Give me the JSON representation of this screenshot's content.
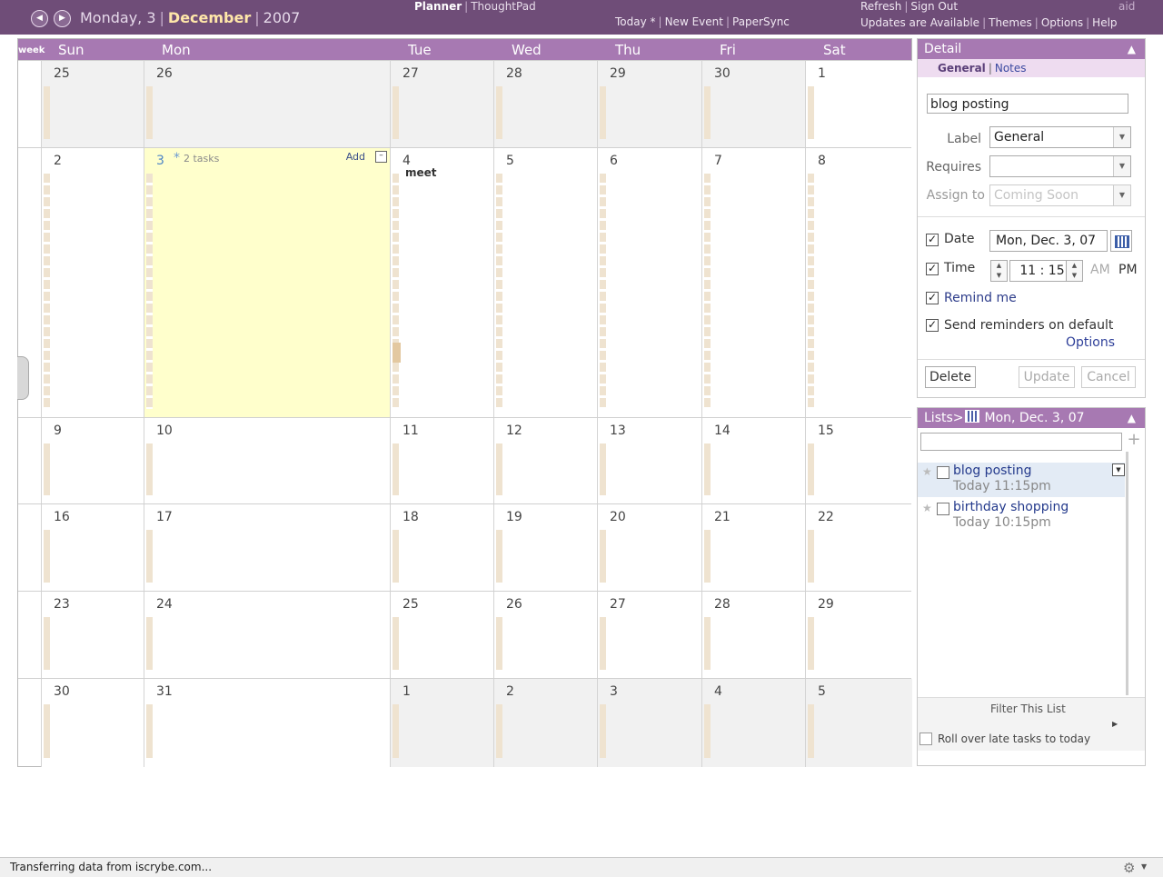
{
  "header": {
    "prev_icon": "chevron-left-icon",
    "next_icon": "chevron-right-icon",
    "weekday_day": "Monday, 3",
    "month": "December",
    "year": "2007",
    "app_active": "Planner",
    "app_other": "ThoughtPad",
    "today_link": "Today *",
    "new_event_link": "New Event",
    "papersync_link": "PaperSync",
    "refresh_link": "Refresh",
    "signout_link": "Sign Out",
    "updates_link": "Updates are Available",
    "themes_link": "Themes",
    "options_link": "Options",
    "help_link": "Help",
    "user": "aid"
  },
  "calendar": {
    "week_tag": "week",
    "weekdays": [
      "Sun",
      "Mon",
      "Tue",
      "Wed",
      "Thu",
      "Fri",
      "Sat"
    ],
    "weeks": [
      [
        "25",
        "26",
        "27",
        "28",
        "29",
        "30",
        "1"
      ],
      [
        "2",
        "3",
        "4",
        "5",
        "6",
        "7",
        "8"
      ],
      [
        "9",
        "10",
        "11",
        "12",
        "13",
        "14",
        "15"
      ],
      [
        "16",
        "17",
        "18",
        "19",
        "20",
        "21",
        "22"
      ],
      [
        "23",
        "24",
        "25",
        "26",
        "27",
        "28",
        "29"
      ],
      [
        "30",
        "31",
        "1",
        "2",
        "3",
        "4",
        "5"
      ]
    ],
    "today_star": "*",
    "today_tasks": "2 tasks",
    "add_label": "Add",
    "collapse_symbol": "–",
    "event_tue_4": "meet"
  },
  "detail": {
    "title": "Detail",
    "collapse_icon": "double-chevron-up-icon",
    "tab_general": "General",
    "tab_notes": "Notes",
    "task_title_value": "blog posting",
    "label_label": "Label",
    "label_value": "General",
    "requires_label": "Requires",
    "requires_value": "",
    "assign_label": "Assign to",
    "assign_value": "Coming Soon",
    "date_label": "Date",
    "date_value": "Mon, Dec. 3, 07",
    "time_label": "Time",
    "time_value": "11 : 15",
    "am": "AM",
    "pm": "PM",
    "remind_label": "Remind me",
    "send_reminders_label": "Send reminders on default",
    "options_link": "Options",
    "delete_btn": "Delete",
    "update_btn": "Update",
    "cancel_btn": "Cancel"
  },
  "lists": {
    "title_prefix": "Lists>",
    "title_date": "Mon, Dec. 3, 07",
    "new_task_placeholder": "",
    "add_symbol": "+",
    "tasks": [
      {
        "name": "blog posting",
        "due": "Today  11:15pm"
      },
      {
        "name": "birthday shopping",
        "due": "Today  10:15pm"
      }
    ],
    "filter_label": "Filter This List",
    "rollover_label": "Roll over late tasks to today"
  },
  "status": {
    "text": "Transferring data from iscrybe.com..."
  },
  "colors": {
    "brand": "#6f4d78",
    "header_band": "#a779b2",
    "today_cell": "#ffffcc",
    "selected_task": "#e3ebf5"
  }
}
